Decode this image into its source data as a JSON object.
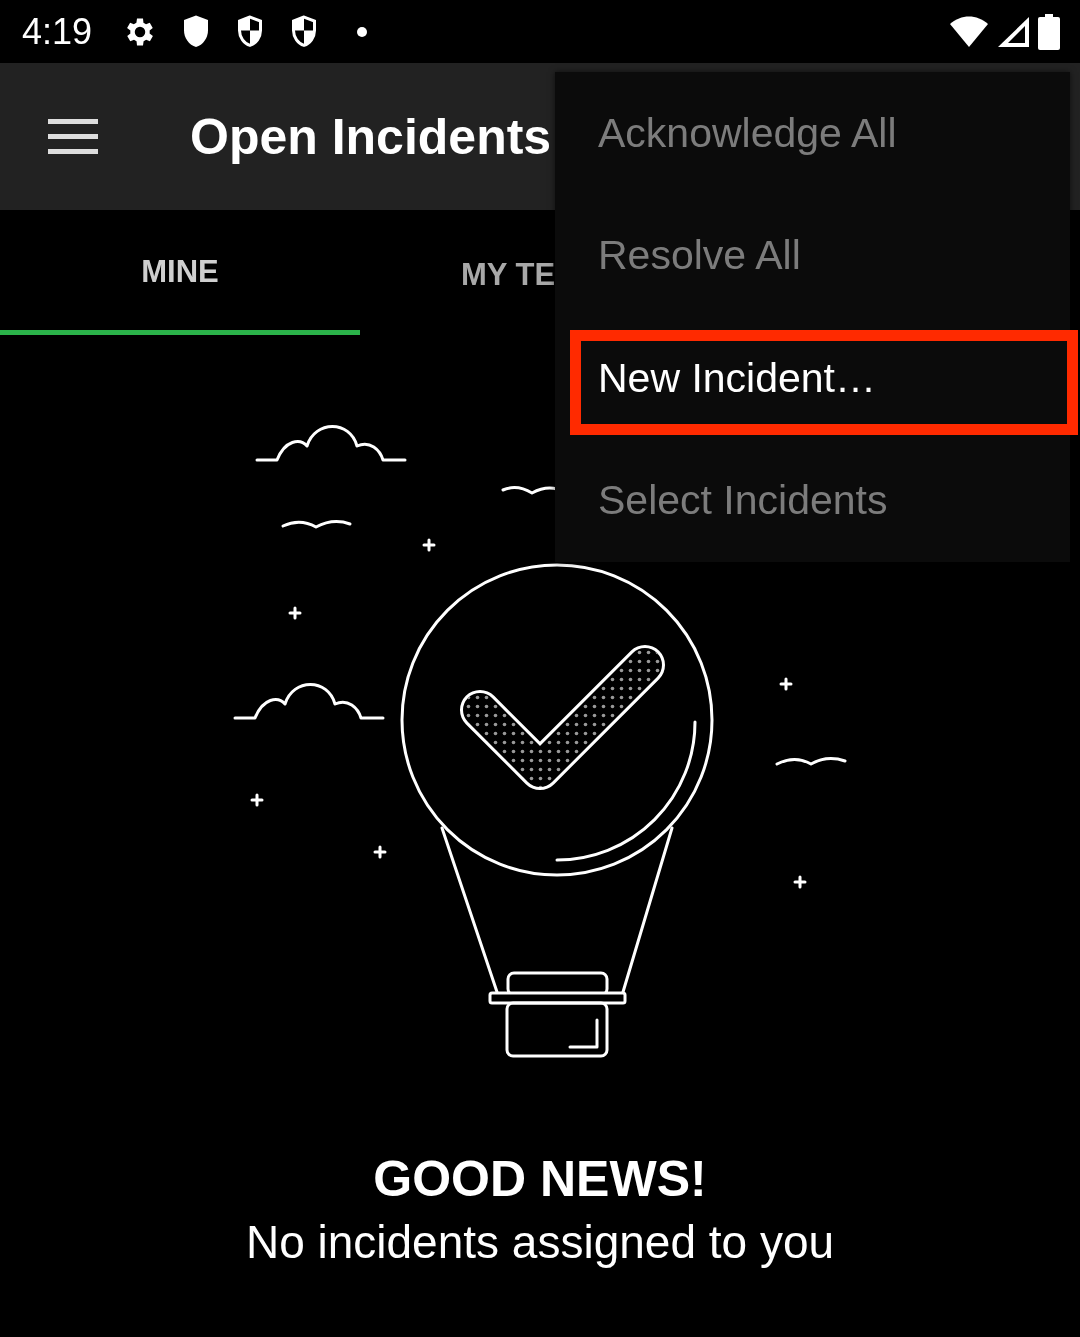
{
  "status_bar": {
    "time": "4:19"
  },
  "app_bar": {
    "title": "Open Incidents"
  },
  "tabs": [
    {
      "label": "MINE",
      "selected": true
    },
    {
      "label": "MY TE",
      "selected": false
    }
  ],
  "empty_state": {
    "title": "GOOD NEWS!",
    "message": "No incidents assigned to you"
  },
  "menu": {
    "items": [
      {
        "label": "Acknowledge All",
        "disabled": true,
        "highlighted": false
      },
      {
        "label": "Resolve All",
        "disabled": true,
        "highlighted": false
      },
      {
        "label": "New Incident…",
        "disabled": false,
        "highlighted": true
      },
      {
        "label": "Select Incidents",
        "disabled": true,
        "highlighted": false
      }
    ]
  }
}
